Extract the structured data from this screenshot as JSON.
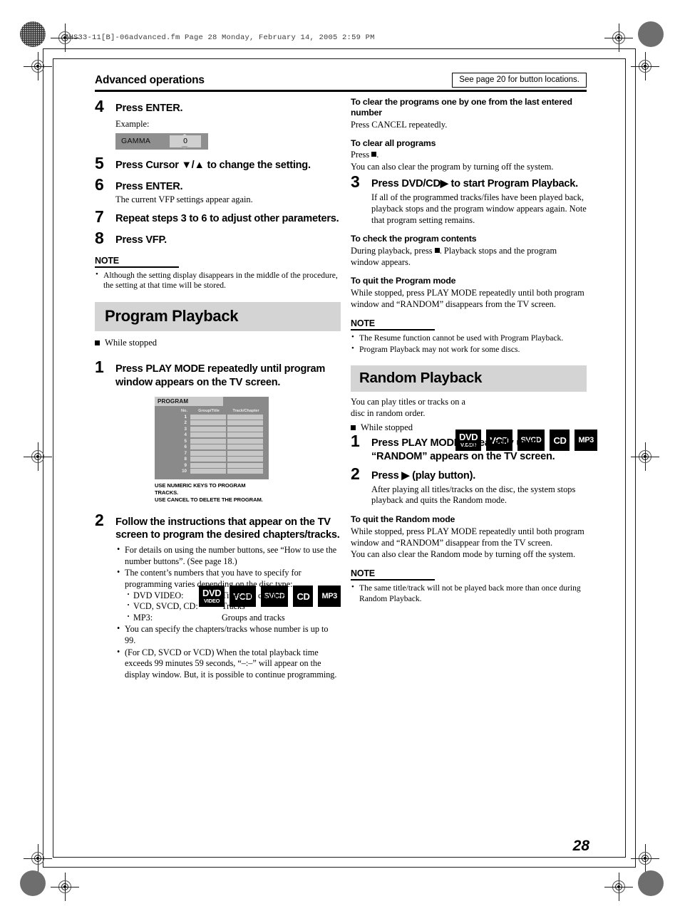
{
  "file_stamp": "THS33-11[B]-06advanced.fm  Page 28  Monday, February 14, 2005  2:59 PM",
  "header": {
    "title": "Advanced operations",
    "see_page_note": "See page 20 for button locations."
  },
  "page_number": "28",
  "left_column": {
    "steps": [
      {
        "num": "4",
        "text": "Press ENTER."
      },
      {
        "num": "5",
        "text": "Press Cursor ▼/▲ to change the setting."
      },
      {
        "num": "6",
        "text": "Press ENTER."
      },
      {
        "num": "7",
        "text": "Repeat steps 3 to 6 to adjust other parameters."
      },
      {
        "num": "8",
        "text": "Press VFP."
      }
    ],
    "example_label": "Example:",
    "gamma": {
      "label": "GAMMA",
      "value": "0",
      "up_icon": "triangle-up-icon",
      "down_icon": "triangle-down-icon"
    },
    "step6_body": "The current VFP settings appear again.",
    "note": {
      "title": "NOTE",
      "items": [
        "Although the setting display disappears in the middle of the procedure, the setting at that time will be stored."
      ]
    },
    "section": {
      "banner": "Program Playback",
      "while_stopped": "While stopped",
      "badges": [
        {
          "line1": "DVD",
          "line2": "VIDEO"
        },
        {
          "line1": "VCD",
          "line2": ""
        },
        {
          "line1": "SVCD",
          "line2": ""
        },
        {
          "line1": "CD",
          "line2": ""
        },
        {
          "line1": "MP3",
          "line2": ""
        }
      ],
      "step1": {
        "num": "1",
        "text": "Press PLAY MODE repeatedly until program window appears on the TV screen."
      },
      "program_window": {
        "tab_label": "PROGRAM",
        "columns": [
          "No.",
          "Group/Title",
          "Track/Chapter"
        ],
        "rows": [
          "1",
          "2",
          "3",
          "4",
          "5",
          "6",
          "7",
          "8",
          "9",
          "10"
        ],
        "footer_line1": "USE NUMERIC KEYS TO PROGRAM TRACKS.",
        "footer_line2": "USE CANCEL TO DELETE THE PROGRAM."
      },
      "step2": {
        "num": "2",
        "text": "Follow the instructions that appear on the TV screen to program the desired chapters/tracks."
      },
      "step2_bullets": [
        "For details on using the number buttons, see “How to use the number buttons”. (See page 18.)",
        "The content’s numbers that you have to specify for programming varies depending on the disc type:",
        "You can specify the chapters/tracks whose number is up to 99.",
        "(For CD, SVCD or VCD) When the total playback time exceeds 99 minutes 59 seconds, “–:–” will appear on the display window. But, it is possible to continue programming."
      ],
      "disc_types": [
        {
          "key": "DVD VIDEO:",
          "value": "Titles and chapters"
        },
        {
          "key": "VCD, SVCD, CD:",
          "value": "Tracks"
        },
        {
          "key": "MP3:",
          "value": "Groups and tracks"
        }
      ]
    }
  },
  "right_column": {
    "clear_one": {
      "heading": "To clear the programs one by one from the last entered number",
      "body": "Press CANCEL repeatedly."
    },
    "clear_all": {
      "heading": "To clear all programs",
      "body_prefix": "Press",
      "body_suffix": ".",
      "body2": "You can also clear the program by turning off the system."
    },
    "step3": {
      "num": "3",
      "text": "Press DVD/CD▶ to start Program Playback.",
      "body": "If all of the programmed tracks/files have been played back, playback stops and the program window appears again. Note that program setting remains."
    },
    "check_contents": {
      "heading": "To check the program contents",
      "body_prefix": "During playback, press",
      "body_suffix": ". Playback stops and the program window appears."
    },
    "quit_program": {
      "heading": "To quit the Program mode",
      "body": "While stopped, press PLAY MODE repeatedly until both program window and “RANDOM” disappears from the TV screen."
    },
    "note1": {
      "title": "NOTE",
      "items": [
        "The Resume function cannot be used with Program Playback.",
        "Program Playback may not work for some discs."
      ]
    },
    "random_section": {
      "banner": "Random Playback",
      "intro": "You can play titles or tracks on a disc in random order.",
      "while_stopped": "While stopped",
      "badges": [
        {
          "line1": "DVD",
          "line2": "VIDEO"
        },
        {
          "line1": "VCD",
          "line2": ""
        },
        {
          "line1": "SVCD",
          "line2": ""
        },
        {
          "line1": "CD",
          "line2": ""
        },
        {
          "line1": "MP3",
          "line2": ""
        }
      ],
      "step1": {
        "num": "1",
        "text": "Press PLAY MODE repeatedly until “RANDOM” appears on the TV screen."
      },
      "step2": {
        "num": "2",
        "text": "Press ▶ (play button).",
        "body": "After playing all titles/tracks on the disc, the system stops playback and quits the Random mode."
      },
      "quit_random": {
        "heading": "To quit the Random mode",
        "body1": "While stopped, press PLAY MODE repeatedly until both program window and “RANDOM” disappear from the TV screen.",
        "body2": "You can also clear the Random mode by turning off the system."
      },
      "note": {
        "title": "NOTE",
        "items": [
          "The same title/track will not be played back more than once during Random Playback."
        ]
      }
    }
  }
}
